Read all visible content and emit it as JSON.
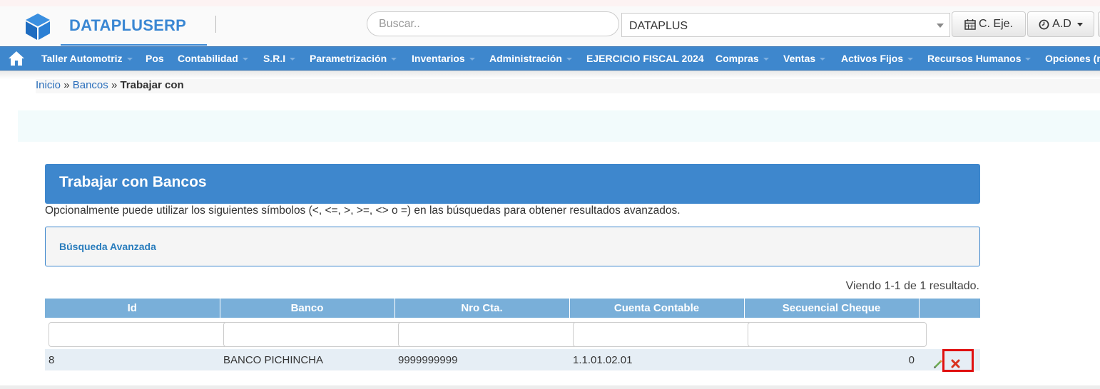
{
  "header": {
    "brand": "DATAPLUSERP",
    "search_placeholder": "Buscar..",
    "company_selected": "DATAPLUS",
    "btn_ceje": "C. Eje.",
    "btn_ad": "A.D"
  },
  "nav": {
    "items": [
      {
        "label": "Taller Automotriz",
        "dropdown": true
      },
      {
        "label": "Pos",
        "dropdown": false
      },
      {
        "label": "Contabilidad",
        "dropdown": true
      },
      {
        "label": "S.R.I",
        "dropdown": true
      },
      {
        "label": "Parametrización",
        "dropdown": true
      },
      {
        "label": "Inventarios",
        "dropdown": true
      },
      {
        "label": "Administración",
        "dropdown": true
      },
      {
        "label": "EJERCICIO FISCAL 2024",
        "dropdown": false
      },
      {
        "label": "Compras",
        "dropdown": true
      },
      {
        "label": "Ventas",
        "dropdown": true
      },
      {
        "label": "Activos Fijos",
        "dropdown": true
      },
      {
        "label": "Recursos Humanos",
        "dropdown": true
      },
      {
        "label": "Opciones (n",
        "dropdown": false
      }
    ]
  },
  "breadcrumb": {
    "home": "Inicio",
    "sep1": "»",
    "section": "Bancos",
    "sep2": "»",
    "current": "Trabajar con"
  },
  "panel": {
    "title": "Trabajar con Bancos",
    "hint": "Opcionalmente puede utilizar los siguientes símbolos (<, <=, >, >=, <> o =) en las búsquedas para obtener resultados avanzados.",
    "advanced_search": "Búsqueda Avanzada",
    "summary": "Viendo 1-1 de 1 resultado."
  },
  "table": {
    "headers": [
      "Id",
      "Banco",
      "Nro Cta.",
      "Cuenta Contable",
      "Secuencial Cheque",
      ""
    ],
    "rows": [
      [
        "8",
        "BANCO PICHINCHA",
        "9999999999",
        "1.1.01.02.01",
        "0"
      ]
    ]
  },
  "colors": {
    "accent": "#3e87cd",
    "table_header": "#79afd9",
    "highlight": "#e01010"
  },
  "icons": [
    "cube-logo-icon",
    "home-icon",
    "calendar-icon",
    "clock-icon",
    "pencil-icon",
    "delete-icon"
  ]
}
